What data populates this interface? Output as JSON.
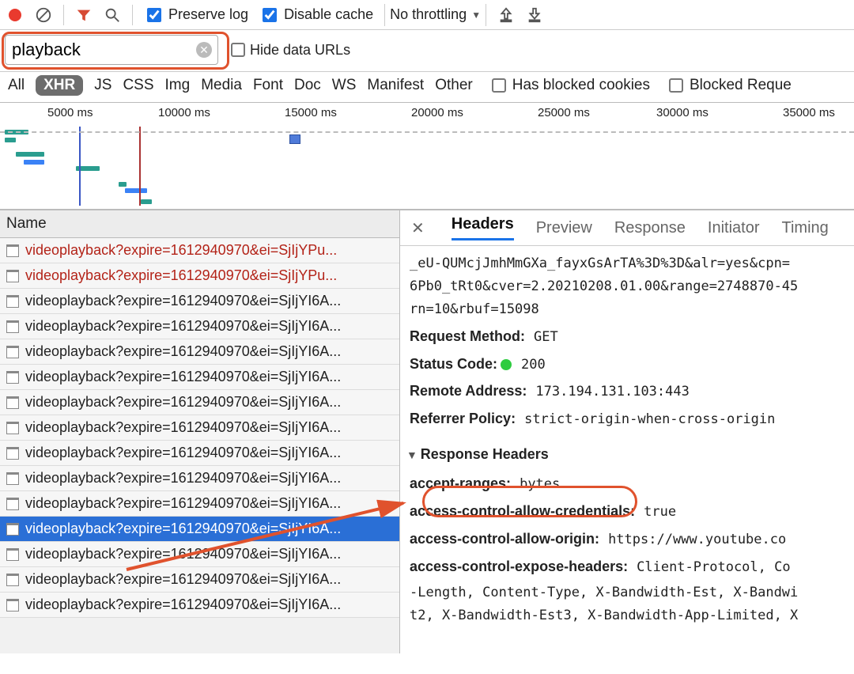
{
  "toolbar": {
    "preserve_log_label": "Preserve log",
    "disable_cache_label": "Disable cache",
    "throttling_label": "No throttling"
  },
  "filter": {
    "value": "playback",
    "hide_data_urls_label": "Hide data URLs"
  },
  "types": {
    "all": "All",
    "xhr": "XHR",
    "js": "JS",
    "css": "CSS",
    "img": "Img",
    "media": "Media",
    "font": "Font",
    "doc": "Doc",
    "ws": "WS",
    "manifest": "Manifest",
    "other": "Other",
    "blocked_cookies": "Has blocked cookies",
    "blocked_req": "Blocked Reque"
  },
  "timeline_ticks": [
    "5000 ms",
    "10000 ms",
    "15000 ms",
    "20000 ms",
    "25000 ms",
    "30000 ms",
    "35000 ms"
  ],
  "name_header": "Name",
  "requests": [
    {
      "label": "videoplayback?expire=1612940970&ei=SjIjYPu...",
      "cls": "red"
    },
    {
      "label": "videoplayback?expire=1612940970&ei=SjIjYPu...",
      "cls": "red"
    },
    {
      "label": "videoplayback?expire=1612940970&ei=SjIjYI6A...",
      "cls": ""
    },
    {
      "label": "videoplayback?expire=1612940970&ei=SjIjYI6A...",
      "cls": ""
    },
    {
      "label": "videoplayback?expire=1612940970&ei=SjIjYI6A...",
      "cls": ""
    },
    {
      "label": "videoplayback?expire=1612940970&ei=SjIjYI6A...",
      "cls": ""
    },
    {
      "label": "videoplayback?expire=1612940970&ei=SjIjYI6A...",
      "cls": ""
    },
    {
      "label": "videoplayback?expire=1612940970&ei=SjIjYI6A...",
      "cls": ""
    },
    {
      "label": "videoplayback?expire=1612940970&ei=SjIjYI6A...",
      "cls": ""
    },
    {
      "label": "videoplayback?expire=1612940970&ei=SjIjYI6A...",
      "cls": ""
    },
    {
      "label": "videoplayback?expire=1612940970&ei=SjIjYI6A...",
      "cls": ""
    },
    {
      "label": "videoplayback?expire=1612940970&ei=SjIjYI6A...",
      "cls": "sel"
    },
    {
      "label": "videoplayback?expire=1612940970&ei=SjIjYI6A...",
      "cls": ""
    },
    {
      "label": "videoplayback?expire=1612940970&ei=SjIjYI6A...",
      "cls": ""
    },
    {
      "label": "videoplayback?expire=1612940970&ei=SjIjYI6A...",
      "cls": ""
    }
  ],
  "tabs": {
    "headers": "Headers",
    "preview": "Preview",
    "response": "Response",
    "initiator": "Initiator",
    "timing": "Timing"
  },
  "general": {
    "url_line1": "_eU-QUMcjJmhMmGXa_fayxGsArTA%3D%3D&alr=yes&cpn=",
    "url_line2": "6Pb0_tRt0&cver=2.20210208.01.00&range=2748870-45",
    "url_line3": "rn=10&rbuf=15098",
    "method_label": "Request Method:",
    "method_value": "GET",
    "status_label": "Status Code:",
    "status_value": "200",
    "remote_label": "Remote Address:",
    "remote_value": "173.194.131.103:443",
    "ref_label": "Referrer Policy:",
    "ref_value": "strict-origin-when-cross-origin"
  },
  "response_headers_title": "Response Headers",
  "resp": [
    {
      "k": "accept-ranges:",
      "v": "bytes"
    },
    {
      "k": "access-control-allow-credentials:",
      "v": "true"
    },
    {
      "k": "access-control-allow-origin:",
      "v": "https://www.youtube.co"
    },
    {
      "k": "access-control-expose-headers:",
      "v": "Client-Protocol, Co"
    }
  ],
  "resp_cont1": "-Length, Content-Type, X-Bandwidth-Est, X-Bandwi",
  "resp_cont2": "t2, X-Bandwidth-Est3, X-Bandwidth-App-Limited, X"
}
